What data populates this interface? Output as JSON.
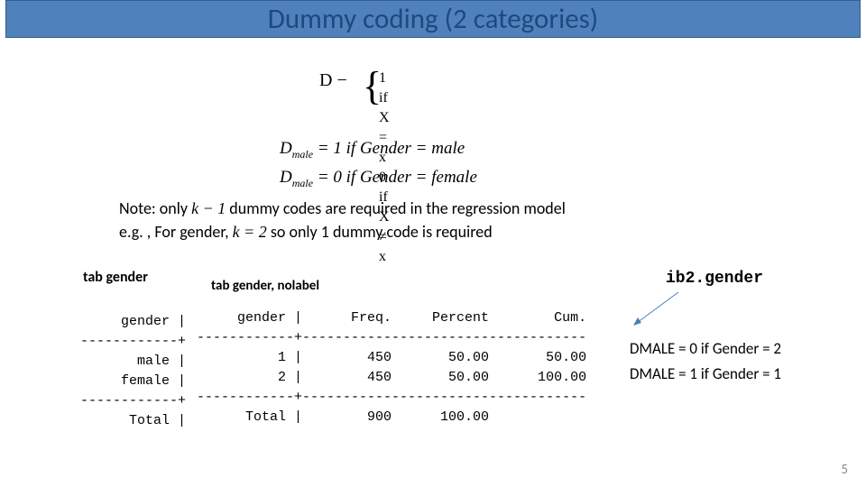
{
  "title": "Dummy coding (2 categories)",
  "formula": {
    "lhs": "D −",
    "case1": "1   if X = x",
    "case2": "0   if X ≠ x"
  },
  "gender_eq": {
    "line1_pre": "D",
    "line1_sub": "male",
    "line1_post": " = 1 if Gender = male",
    "line2_pre": "D",
    "line2_sub": "male",
    "line2_post": " = 0 if Gender = female"
  },
  "note": {
    "line1a": "Note: only ",
    "line1b": "k − 1",
    "line1c": " dummy codes are required in the regression model",
    "line2a": "e.g. , For gender, ",
    "line2b": "k = 2",
    "line2c": " so only 1 dummy code is required"
  },
  "tab1_cmd": "tab gender",
  "tab2_cmd": "tab gender, nolabel",
  "table1": {
    "head": "     gender |",
    "sep": "------------+",
    "row1": "       male |",
    "row2": "     female |",
    "tot": "      Total |"
  },
  "table2": {
    "head": "     gender |      Freq.     Percent        Cum.",
    "sep": "------------+-----------------------------------",
    "row1": "          1 |        450       50.00       50.00",
    "row2": "          2 |        450       50.00      100.00",
    "tot": "      Total |        900      100.00"
  },
  "ib2": "ib2.gender",
  "dmale1": "DMALE = 0 if Gender = 2",
  "dmale2": "DMALE = 1 if Gender = 1",
  "pagenum": "5",
  "chart_data": {
    "type": "table",
    "title": "tab gender, nolabel",
    "columns": [
      "gender",
      "Freq.",
      "Percent",
      "Cum."
    ],
    "rows": [
      {
        "gender": 1,
        "label": "male",
        "Freq.": 450,
        "Percent": 50.0,
        "Cum.": 50.0
      },
      {
        "gender": 2,
        "label": "female",
        "Freq.": 450,
        "Percent": 50.0,
        "Cum.": 100.0
      }
    ],
    "total": {
      "Freq.": 900,
      "Percent": 100.0
    }
  }
}
